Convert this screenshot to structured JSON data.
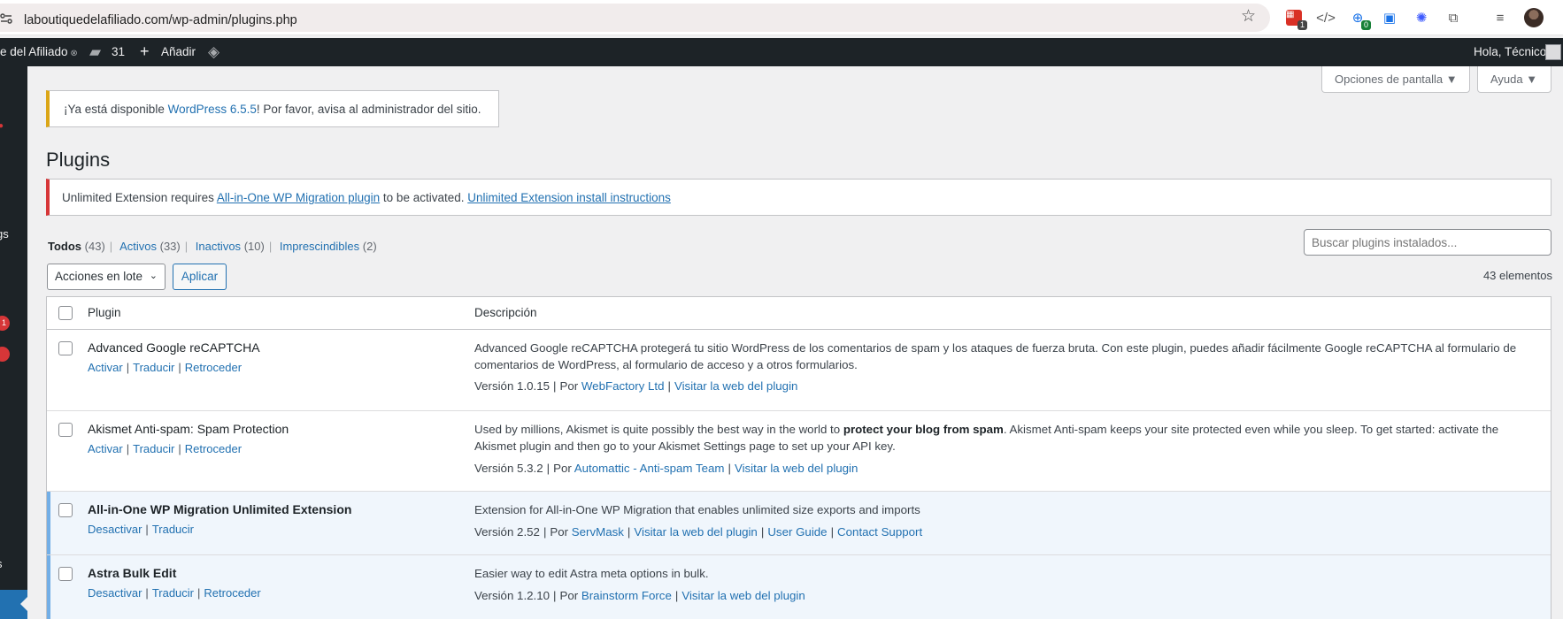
{
  "browser": {
    "url": "laboutiquedelafiliado.com/wp-admin/plugins.php",
    "extensions": [
      {
        "icon": "calendar-icon",
        "badge": "1"
      },
      {
        "icon": "code-icon",
        "badge": ""
      },
      {
        "icon": "globe-icon",
        "badge": "0"
      },
      {
        "icon": "screen-icon",
        "badge": ""
      },
      {
        "icon": "gear-flower-icon",
        "badge": ""
      },
      {
        "icon": "puzzle-icon",
        "badge": ""
      },
      {
        "icon": "media-list-icon",
        "badge": ""
      }
    ]
  },
  "adminbar": {
    "site_name": "e del Afiliado",
    "comments_count": "31",
    "new_label": "Añadir",
    "howdy": "Hola, Técnico"
  },
  "sidebar": {
    "fragments": [
      "gs",
      "s"
    ],
    "badges": [
      "1"
    ]
  },
  "screen_meta": {
    "screen_options": "Opciones de pantalla",
    "help": "Ayuda"
  },
  "update_notice": {
    "prefix": "¡Ya está disponible ",
    "link": "WordPress 6.5.5",
    "suffix": "! Por favor, avisa al administrador del sitio."
  },
  "page": {
    "title": "Plugins"
  },
  "error_notice": {
    "prefix": "Unlimited Extension requires ",
    "link1": "All-in-One WP Migration plugin",
    "middle": " to be activated. ",
    "link2": "Unlimited Extension install instructions"
  },
  "filters": [
    {
      "label": "Todos",
      "count": "(43)"
    },
    {
      "label": "Activos",
      "count": "(33)"
    },
    {
      "label": "Inactivos",
      "count": "(10)"
    },
    {
      "label": "Imprescindibles",
      "count": "(2)"
    }
  ],
  "search": {
    "placeholder": "Buscar plugins instalados..."
  },
  "bulk": {
    "select_label": "Acciones en lote",
    "apply_label": "Aplicar",
    "count": "43 elementos"
  },
  "table": {
    "col_plugin": "Plugin",
    "col_desc": "Descripción",
    "rows": [
      {
        "name": "Advanced Google reCAPTCHA",
        "actions": [
          "Activar",
          "Traducir",
          "Retroceder"
        ],
        "desc": "Advanced Google reCAPTCHA protegerá tu sitio WordPress de los comentarios de spam y los ataques de fuerza bruta. Con este plugin, puedes añadir fácilmente Google reCAPTCHA al formulario de comentarios de WordPress, al formulario de acceso y a otros formularios.",
        "version": "Versión 1.0.15",
        "by": "Por ",
        "author": "WebFactory Ltd",
        "links": [
          "Visitar la web del plugin"
        ]
      },
      {
        "name": "Akismet Anti-spam: Spam Protection",
        "actions": [
          "Activar",
          "Traducir",
          "Retroceder"
        ],
        "desc_a": "Used by millions, Akismet is quite possibly the best way in the world to ",
        "desc_b": "protect your blog from spam",
        "desc_c": ". Akismet Anti-spam keeps your site protected even while you sleep. To get started: activate the Akismet plugin and then go to your Akismet Settings page to set up your API key.",
        "version": "Versión 5.3.2",
        "by": "Por ",
        "author": "Automattic - Anti-spam Team",
        "links": [
          "Visitar la web del plugin"
        ]
      },
      {
        "name": "All-in-One WP Migration Unlimited Extension",
        "actions": [
          "Desactivar",
          "Traducir"
        ],
        "desc": "Extension for All-in-One WP Migration that enables unlimited size exports and imports",
        "version": "Versión 2.52",
        "by": "Por ",
        "author": "ServMask",
        "links": [
          "Visitar la web del plugin",
          "User Guide",
          "Contact Support"
        ]
      },
      {
        "name": "Astra Bulk Edit",
        "actions": [
          "Desactivar",
          "Traducir",
          "Retroceder"
        ],
        "desc": "Easier way to edit Astra meta options in bulk.",
        "version": "Versión 1.2.10",
        "by": "Por ",
        "author": "Brainstorm Force",
        "links": [
          "Visitar la web del plugin"
        ]
      }
    ]
  }
}
